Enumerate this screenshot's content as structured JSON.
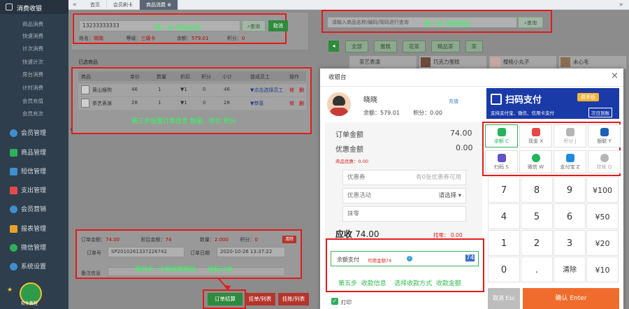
{
  "sidebar": {
    "top_label": "消费收银",
    "sub_items": [
      "商品消费",
      "快速消费",
      "计次消费",
      "快速计次",
      "房台消费",
      "计时消费",
      "会员充值",
      "会员充次"
    ],
    "groups": [
      "会员管理",
      "商品管理",
      "短信管理",
      "支出管理",
      "会员营销",
      "报表管理",
      "微信管理",
      "系统设置"
    ],
    "footer_label": "软件教程"
  },
  "tabs": {
    "nav_back": "«",
    "nav_forward": "»",
    "items": [
      "首页",
      "会员刷卡",
      "商品消费"
    ],
    "active_close": "⊗"
  },
  "member": {
    "card_value": "13233333333",
    "annotation": "第一步  找到会员",
    "query_label": "查询",
    "cancel_label": "取消",
    "name_label": "姓名：",
    "name": "晓晓",
    "level_label": "等级：",
    "level": "三级卡",
    "balance_label": "余额：",
    "balance": "579.01",
    "points_label": "积分：",
    "points": "0"
  },
  "product_search": {
    "placeholder": "请输入商品名称/编码/简码进行查询",
    "annotation": "第二步  选择商品",
    "query_label": "查询"
  },
  "categories": [
    "全部",
    "蛋糕",
    "花茶",
    "精品茶",
    "茶"
  ],
  "product_cards": [
    "茶艺表演",
    "巧克力蛋糕",
    "樱桃小丸子",
    "未心毛"
  ],
  "selected": {
    "title": "已选商品",
    "headers": [
      "商品",
      "单价",
      "数量",
      "折扣",
      "积分",
      "小计",
      "提成员工",
      "操作"
    ],
    "rows": [
      {
        "name": "黄山猴狗",
        "price": "46",
        "qty": "1",
        "disc": "▼1",
        "points": "0",
        "subtotal": "46",
        "staff": "▼点击选择员工",
        "ops": [
          "修",
          "删"
        ]
      },
      {
        "name": "茶艺表演",
        "price": "28",
        "qty": "1",
        "disc": "▼1",
        "points": "0",
        "subtotal": "28",
        "staff": "▼恭喜",
        "ops": [
          "修",
          "删"
        ]
      }
    ],
    "annotation": "第三步设置订单信息  数量、折扣  积分"
  },
  "summary": {
    "order_amount_label": "订单金额：",
    "order_amount": "74.00",
    "discount_amount_label": "折后金额：",
    "discount_amount": "74",
    "qty_label": "数量：",
    "qty": "2.000",
    "points_label": "积分：",
    "points": "0",
    "clear_label": "清除",
    "order_no_label": "订单号",
    "order_no": "SP2010261337226742",
    "order_date_label": "订单日期",
    "order_date": "2020-10-26 13:37:22",
    "remark_label": "备注信息",
    "annotation": "第四步  订单结算按钮      挂起订单"
  },
  "bottom_buttons": [
    "订单结算",
    "挂单/列表",
    "挂账/列表"
  ],
  "checkout": {
    "title": "收银台",
    "close": "×",
    "member_name": "晓晓",
    "recharge_label": "充值",
    "balance_label": "余额：",
    "balance": "579.01",
    "points_label": "积分：",
    "points": "0.00",
    "order_amount_label": "订单金额",
    "order_amount": "74.00",
    "discount_label": "优惠金额",
    "discount": "0.00",
    "product_discount_label": "商品优惠：",
    "product_discount": "0.00",
    "coupon_label": "优惠券",
    "coupon_hint": "有0张优惠券可用",
    "activity_label": "优惠活动",
    "activity_value": "请选择",
    "round_label": "抹零",
    "receivable_label": "应收",
    "receivable": "74.00",
    "change_label": "找零：",
    "change": "0.00",
    "balance_pay_label": "余额支付",
    "balance_pay_hint": "可用金额74",
    "balance_pay_value": "74",
    "annotation": "第五步  收款信息    选择收款方式  收款金额",
    "print_label": "打印",
    "scan_banner": {
      "title": "扫码支付",
      "badge": "费率低",
      "subtitle": "支持支付宝、微信、信用卡支付",
      "next_day": "次日到账"
    },
    "pay_methods": [
      {
        "label": "余额 C",
        "color": "#22b35b",
        "active": true
      },
      {
        "label": "现金 X",
        "color": "#e64747",
        "active": false
      },
      {
        "label": "积分 J",
        "color": "#b5b5b5",
        "active": false
      },
      {
        "label": "银联 Y",
        "color": "#1d5fb5",
        "active": false
      },
      {
        "label": "扫码 S",
        "color": "#6152c8",
        "active": false
      },
      {
        "label": "微信 W",
        "color": "#22b35b",
        "active": false
      },
      {
        "label": "支付宝 Z",
        "color": "#1d8be0",
        "active": false
      },
      {
        "label": "挂帐 Q",
        "color": "#b5b5b5",
        "active": false
      }
    ],
    "keypad": [
      "7",
      "8",
      "9",
      "¥100",
      "4",
      "5",
      "6",
      "¥50",
      "1",
      "2",
      "3",
      "¥20",
      "0",
      ".",
      "清除",
      "¥10"
    ],
    "cancel_label": "取消 Esc",
    "confirm_label": "确认 Enter"
  }
}
